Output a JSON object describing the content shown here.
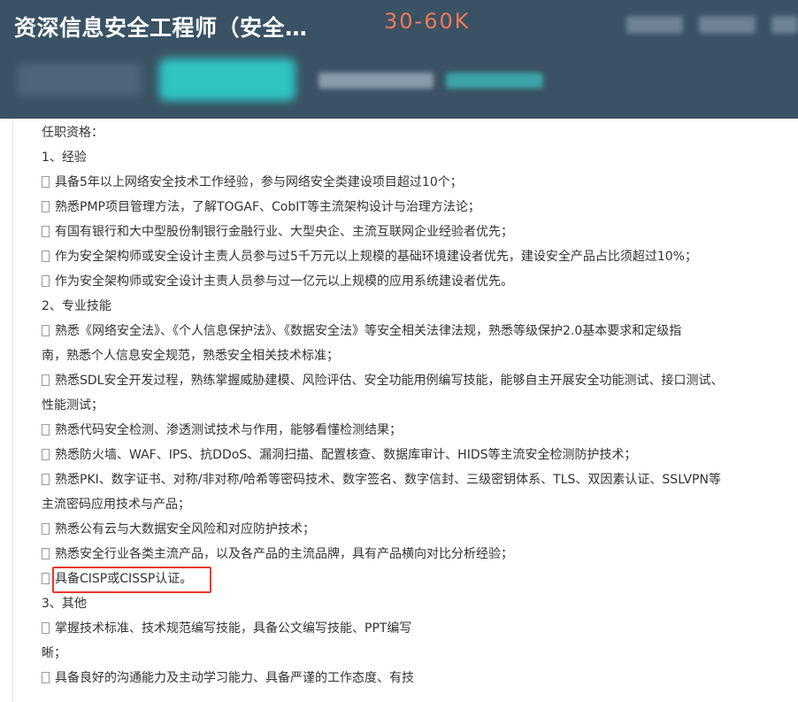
{
  "header": {
    "job_title": "资深信息安全工程师（安全…",
    "salary": "30-60K"
  },
  "requirements": {
    "heading": "任职资格：",
    "sections": [
      {
        "title": "1、经验",
        "items": [
          "具备5年以上网络安全技术工作经验，参与网络安全类建设项目超过10个；",
          "熟悉PMP项目管理方法，了解TOGAF、CobIT等主流架构设计与治理方法论；",
          "有国有银行和大中型股份制银行金融行业、大型央企、主流互联网企业经验者优先；",
          "作为安全架构师或安全设计主责人员参与过5千万元以上规模的基础环境建设者优先，建设安全产品占比须超过10%；",
          "作为安全架构师或安全设计主责人员参与过一亿元以上规模的应用系统建设者优先。"
        ]
      },
      {
        "title": "2、专业技能",
        "items": [
          "熟悉《网络安全法》、《个人信息保护法》、《数据安全法》等安全相关法律法规，熟悉等级保护2.0基本要求和定级指",
          "南，熟悉个人信息安全规范，熟悉安全相关技术标准；",
          "熟悉SDL安全开发过程，熟练掌握威胁建模、风险评估、安全功能用例编写技能，能够自主开展安全功能测试、接口测试、",
          "性能测试；",
          "熟悉代码安全检测、渗透测试技术与作用，能够看懂检测结果；",
          "熟悉防火墙、WAF、IPS、抗DDoS、漏洞扫描、配置核查、数据库审计、HIDS等主流安全检测防护技术；",
          "熟悉PKI、数字证书、对称/非对称/哈希等密码技术、数字签名、数字信封、三级密钥体系、TLS、双因素认证、SSLVPN等",
          "主流密码应用技术与产品；",
          "熟悉公有云与大数据安全风险和对应防护技术；",
          "熟悉安全行业各类主流产品，以及各产品的主流品牌，具有产品横向对比分析经验；",
          "具备CISP或CISSP认证。"
        ]
      },
      {
        "title": "3、其他",
        "items": [
          "掌握技术标准、技术规范编写技能，具备公文编写技能、PPT编写",
          "晰；",
          "具备良好的沟通能力及主动学习能力、具备严谨的工作态度、有技"
        ]
      }
    ]
  }
}
